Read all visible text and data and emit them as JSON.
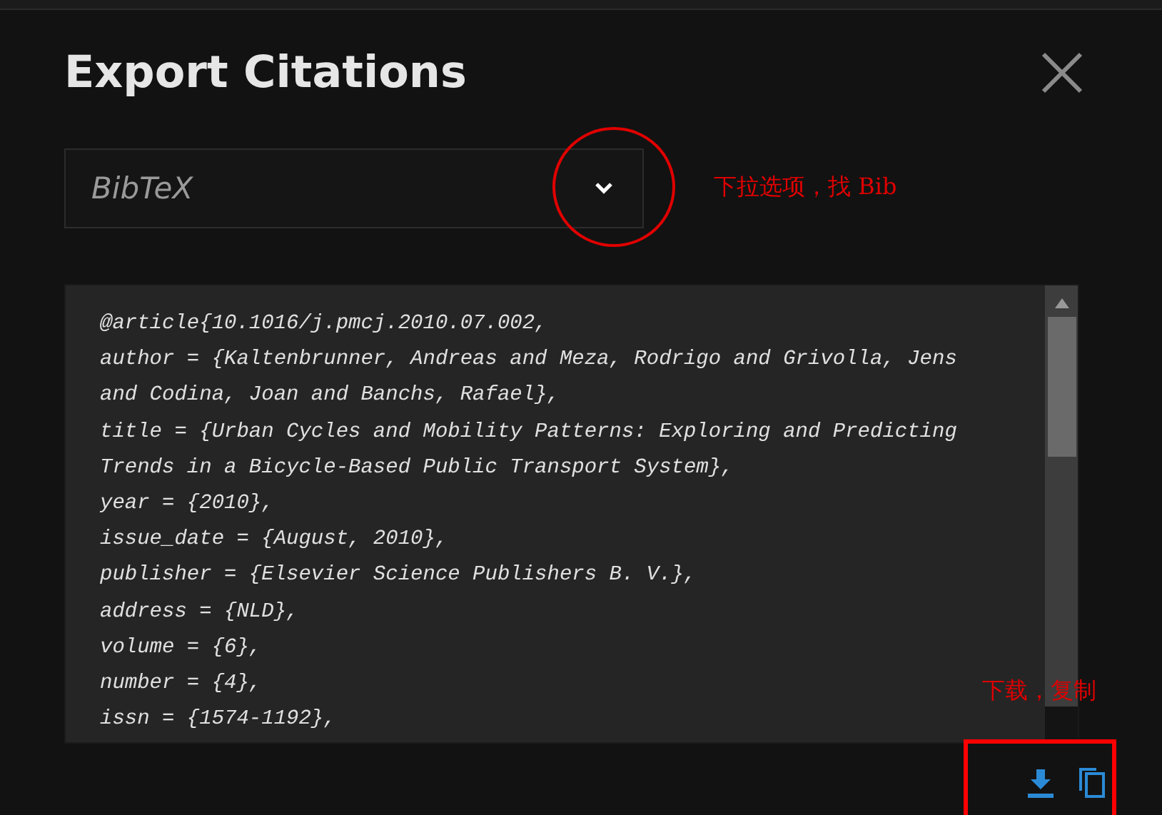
{
  "dialog": {
    "title": "Export Citations",
    "format_select": {
      "value": "BibTeX"
    },
    "citation_lines": [
      "@article{10.1016/j.pmcj.2010.07.002,",
      "author = {Kaltenbrunner, Andreas and Meza, Rodrigo and Grivolla, Jens",
      "and Codina, Joan and Banchs, Rafael},",
      "title = {Urban Cycles and Mobility Patterns: Exploring and Predicting",
      "Trends in a Bicycle-Based Public Transport System},",
      "year = {2010},",
      "issue_date = {August, 2010},",
      "publisher = {Elsevier Science Publishers B. V.},",
      "address = {NLD},",
      "volume = {6},",
      "number = {4},",
      "issn = {1574-1192},"
    ]
  },
  "annotations": [
    {
      "kind": "circle-note",
      "text": "下拉选项，找 Bib"
    },
    {
      "kind": "box-note",
      "text": "下载，复制"
    }
  ]
}
